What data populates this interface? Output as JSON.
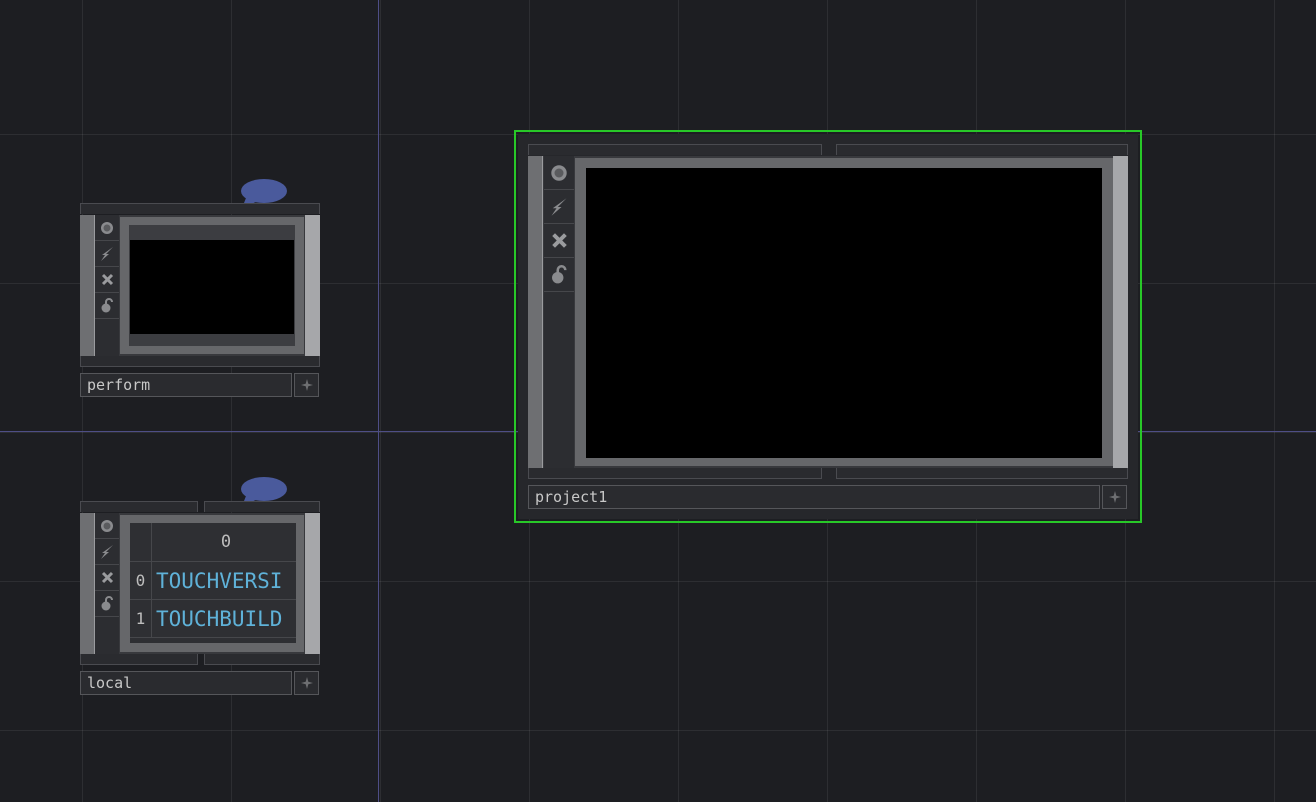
{
  "network": {
    "nodes": {
      "perform": {
        "name": "perform",
        "has_comment": true
      },
      "local": {
        "name": "local",
        "has_comment": true,
        "table": {
          "header": "0",
          "rows": [
            {
              "index": "0",
              "value": "TOUCHVERSI"
            },
            {
              "index": "1",
              "value": "TOUCHBUILD"
            }
          ]
        }
      },
      "project1": {
        "name": "project1",
        "selected": true
      }
    }
  },
  "icons": {
    "viewer_toggle": "target-icon",
    "bypass": "lightning-icon",
    "delete": "close-icon",
    "lock": "lock-icon",
    "add": "plus-icon",
    "comment": "speech-bubble-icon"
  },
  "colors": {
    "background": "#1d1e22",
    "selection": "#28c828",
    "comment_bubble": "#4a5a9c",
    "table_text": "#5fb2d9"
  }
}
